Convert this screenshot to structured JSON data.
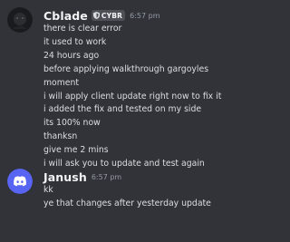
{
  "messages": [
    {
      "username": "Cblade",
      "tag": "CYBR",
      "timestamp": "6:57 pm",
      "avatar_icon": "dark-avatar-icon",
      "lines": [
        "there is clear error",
        "it used to work",
        "24 hours ago",
        "before applying walkthrough gargoyles",
        "moment",
        "i will apply client update right now to fix it",
        "i added the fix and tested on my side",
        "its 100% now",
        "thanksn",
        "give me 2 mins",
        "i will ask you to update and test again"
      ]
    },
    {
      "username": "Janush",
      "timestamp": "6:57 pm",
      "avatar_icon": "discord-logo-icon",
      "avatar_color": "#5865f2",
      "lines": [
        "kk",
        "ye that changes after yesterday update"
      ]
    }
  ]
}
